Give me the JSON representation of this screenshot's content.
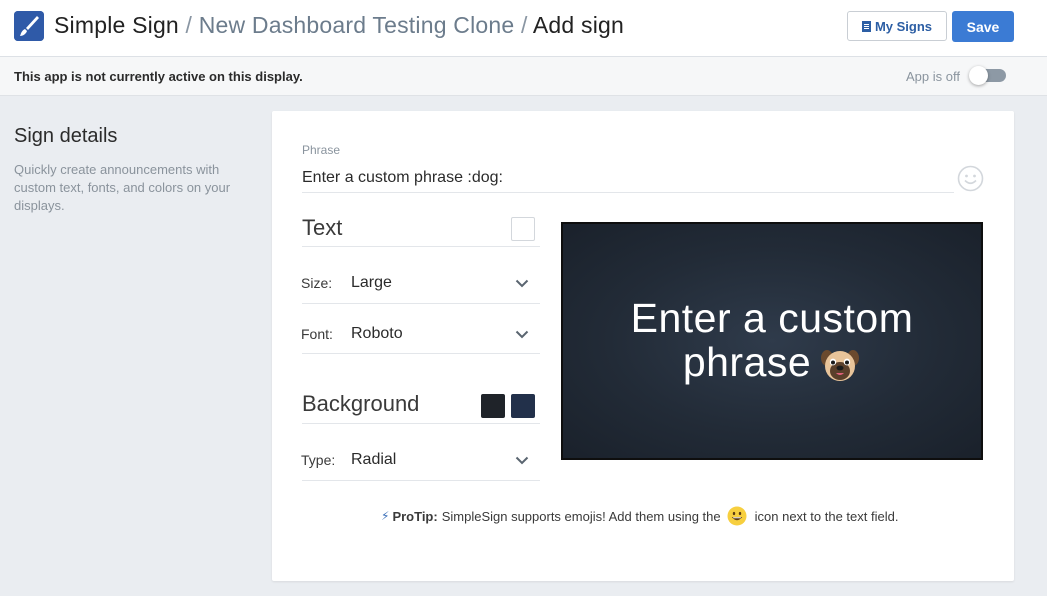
{
  "header": {
    "app_name": "Simple Sign",
    "separator": "/",
    "breadcrumb_parent": "New Dashboard Testing Clone",
    "breadcrumb_current": "Add sign",
    "my_signs_label": "My Signs",
    "save_label": "Save"
  },
  "notice": {
    "message": "This app is not currently active on this display.",
    "toggle_label": "App is off",
    "toggle_on": false
  },
  "sidebar": {
    "title": "Sign details",
    "description": "Quickly create announcements with custom text, fonts, and colors on your displays."
  },
  "form": {
    "phrase_label": "Phrase",
    "phrase_value": "Enter a custom phrase :dog:",
    "text_section": "Text",
    "text_color": "#ffffff",
    "size_label": "Size:",
    "size_value": "Large",
    "font_label": "Font:",
    "font_value": "Roboto",
    "background_section": "Background",
    "bg_color_1": "#1f2329",
    "bg_color_2": "#22304a",
    "type_label": "Type:",
    "type_value": "Radial"
  },
  "preview": {
    "line1": "Enter a custom",
    "line2": "phrase",
    "emoji": "dog-emoji"
  },
  "protip": {
    "label": "ProTip:",
    "text_before": "SimpleSign supports emojis! Add them using the",
    "text_after": "icon next to the text field."
  },
  "colors": {
    "accent": "#3b7bd4",
    "link": "#2c5ea4"
  }
}
